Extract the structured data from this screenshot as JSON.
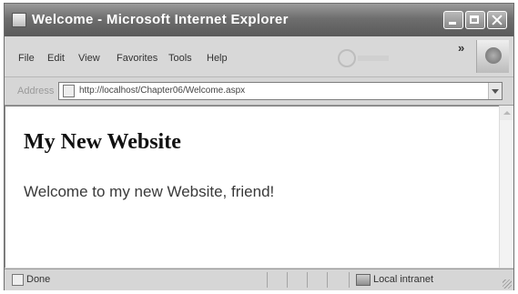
{
  "window": {
    "title": "Welcome - Microsoft Internet Explorer"
  },
  "menubar": {
    "items": [
      "File",
      "Edit",
      "View",
      "Favorites",
      "Tools",
      "Help"
    ]
  },
  "address": {
    "label": "Address",
    "url": "http://localhost/Chapter06/Welcome.aspx"
  },
  "page": {
    "heading": "My New Website",
    "text": "Welcome to my new Website, friend!"
  },
  "status": {
    "text": "Done",
    "zone": "Local intranet"
  },
  "icons": {
    "app": "ie-page-icon",
    "throbber": "throbber-icon",
    "ie_logo": "windows-logo-icon",
    "page": "page-icon",
    "zone": "intranet-zone-icon"
  }
}
